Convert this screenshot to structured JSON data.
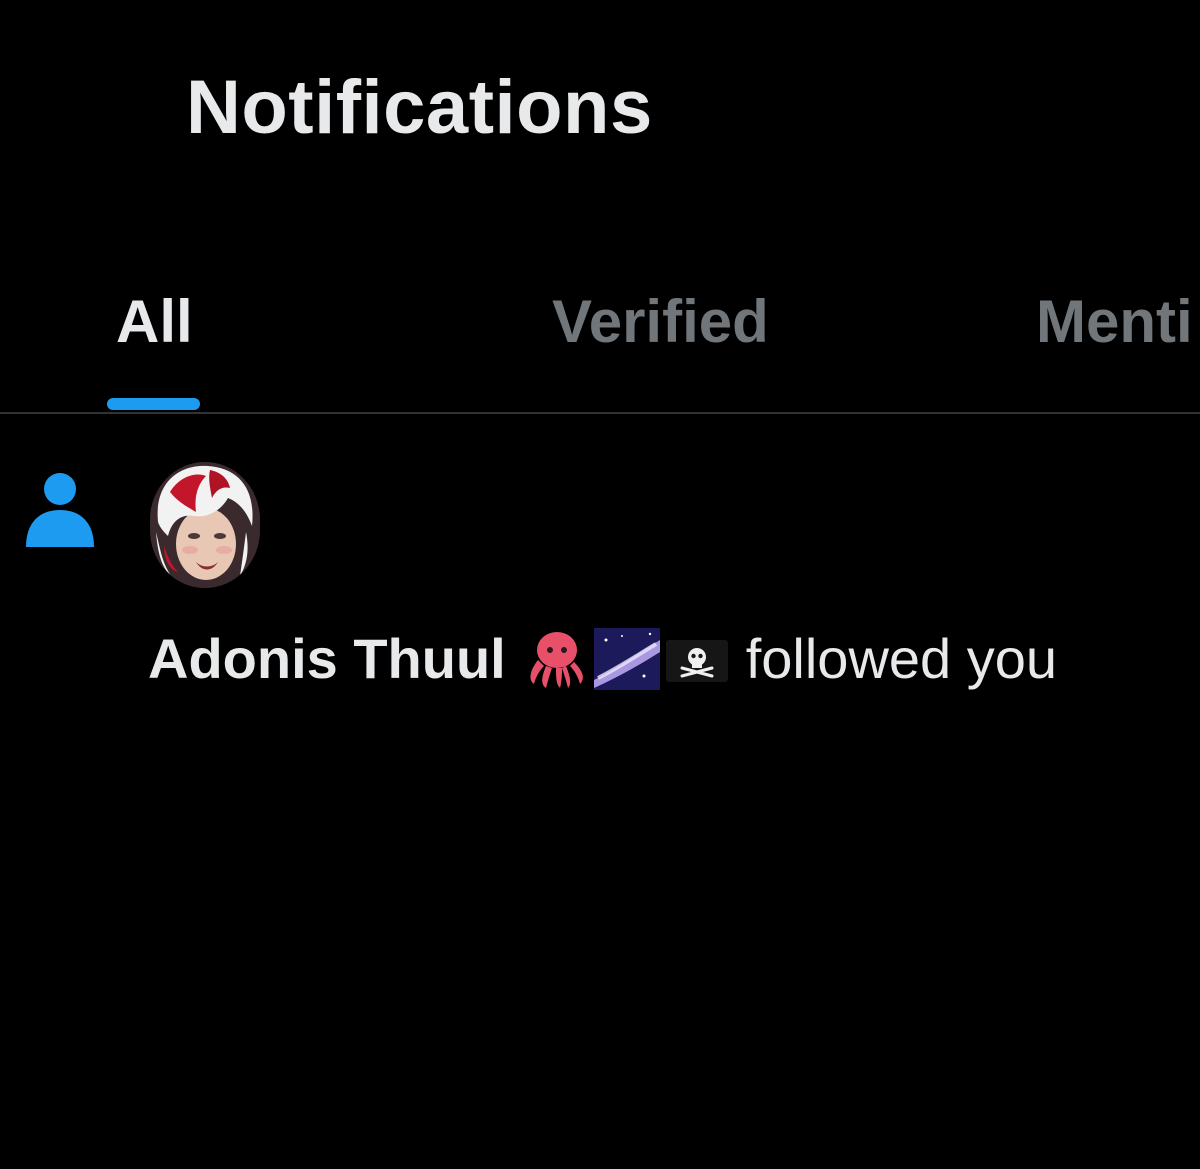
{
  "header": {
    "title": "Notifications"
  },
  "tabs": [
    {
      "label": "All",
      "active": true
    },
    {
      "label": "Verified",
      "active": false
    },
    {
      "label": "Menti",
      "active": false
    }
  ],
  "notification": {
    "type_icon": "person-icon",
    "avatar_icon": "user-avatar",
    "user_name": "Adonis Thuul",
    "emojis": [
      "octopus-emoji",
      "milky-way-emoji",
      "pirate-flag-emoji"
    ],
    "action": "followed you"
  },
  "colors": {
    "background": "#000000",
    "primary_text": "#e7e9ea",
    "secondary_text": "#71767b",
    "accent": "#1d9bf0",
    "divider": "#2f3336"
  }
}
